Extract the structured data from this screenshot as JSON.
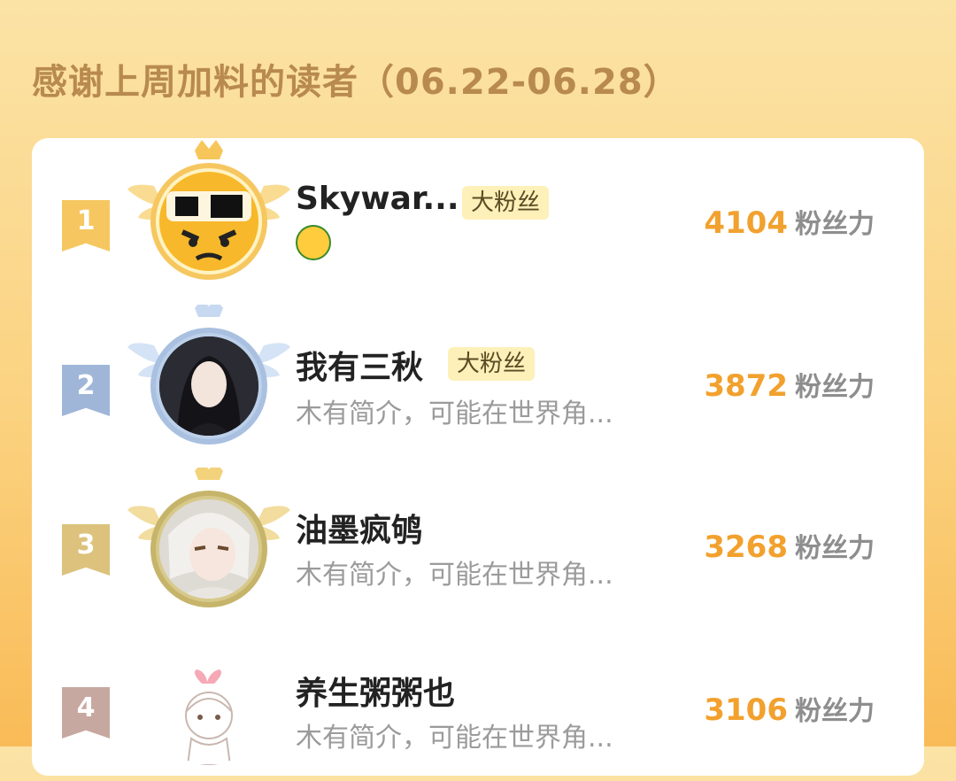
{
  "header": {
    "title": "感谢上周加料的读者（06.22-06.28）"
  },
  "colors": {
    "accent_orange": "#f2a12e",
    "rank1": "#f6c760",
    "rank2": "#9fb6d8",
    "rank3": "#dcc27c",
    "rank4": "#c7a8a0"
  },
  "leaderboard": {
    "score_unit": "粉丝力",
    "entries": [
      {
        "rank": "1",
        "name": "Skywar...",
        "badge": "大粉丝",
        "bio": "",
        "emoji_icon": "money-face-emoji-icon",
        "score": "4104"
      },
      {
        "rank": "2",
        "name": "我有三秋",
        "badge": "大粉丝",
        "bio": "木有简介，可能在世界角...",
        "score": "3872"
      },
      {
        "rank": "3",
        "name": "油墨疯鸲",
        "badge": "",
        "bio": "木有简介，可能在世界角...",
        "score": "3268"
      },
      {
        "rank": "4",
        "name": "养生粥粥也",
        "badge": "",
        "bio": "木有简介，可能在世界角...",
        "score": "3106"
      }
    ]
  }
}
